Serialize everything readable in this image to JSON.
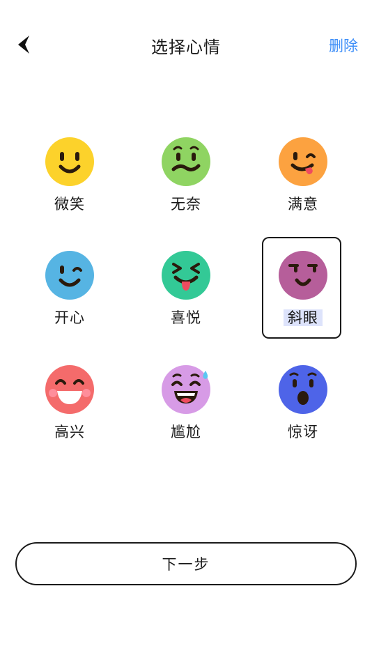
{
  "header": {
    "title": "选择心情",
    "delete_label": "删除"
  },
  "moods": [
    {
      "label": "微笑",
      "icon": "smile-face-icon",
      "color": "#fcd22b"
    },
    {
      "label": "无奈",
      "icon": "helpless-face-icon",
      "color": "#8fd462"
    },
    {
      "label": "满意",
      "icon": "satisfied-face-icon",
      "color": "#fca240"
    },
    {
      "label": "开心",
      "icon": "happy-wink-face-icon",
      "color": "#56b4e3"
    },
    {
      "label": "喜悦",
      "icon": "joy-face-icon",
      "color": "#33c996"
    },
    {
      "label": "斜眼",
      "icon": "side-eye-face-icon",
      "color": "#b65e9a"
    },
    {
      "label": "高兴",
      "icon": "glad-face-icon",
      "color": "#f46b6b"
    },
    {
      "label": "尴尬",
      "icon": "awkward-face-icon",
      "color": "#d79be6"
    },
    {
      "label": "惊讶",
      "icon": "surprised-face-icon",
      "color": "#4e64e8"
    }
  ],
  "selected_mood": "斜眼",
  "footer": {
    "next_label": "下一步"
  }
}
